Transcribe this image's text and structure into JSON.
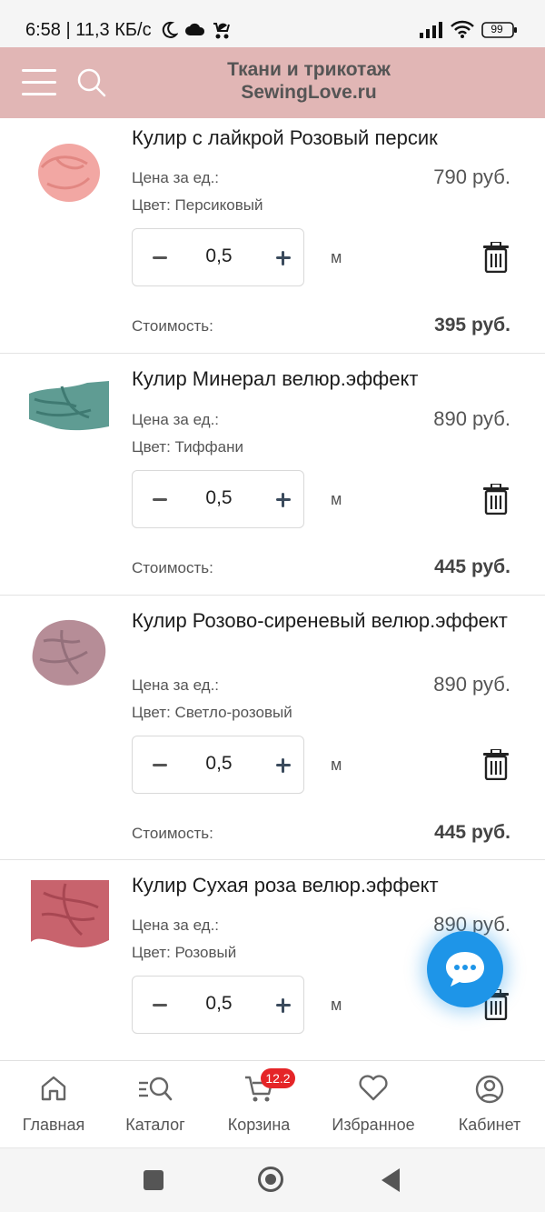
{
  "status_bar": {
    "time_speed": "6:58 | 11,3 КБ/с",
    "battery": "99"
  },
  "header": {
    "brand_line1": "Ткани и трикотаж",
    "brand_line2": "SewingLove.ru"
  },
  "cart": {
    "price_label": "Цена за ед.:",
    "cost_label": "Стоимость:",
    "items": [
      {
        "name": "Кулир с лайкрой Розовый персик",
        "price": "790 руб.",
        "color": "Цвет: Персиковый",
        "qty": "0,5",
        "unit": "м",
        "cost": "395 руб.",
        "swatch": "#f2a7a3"
      },
      {
        "name": "Кулир Минерал велюр.эффект",
        "price": "890 руб.",
        "color": "Цвет: Тиффани",
        "qty": "0,5",
        "unit": "м",
        "cost": "445 руб.",
        "swatch": "#5f9c93"
      },
      {
        "name": "Кулир Розово-сиреневый велюр.эффект",
        "price": "890 руб.",
        "color": "Цвет: Светло-розовый",
        "qty": "0,5",
        "unit": "м",
        "cost": "445 руб.",
        "swatch": "#b68d97"
      },
      {
        "name": "Кулир Сухая роза велюр.эффект",
        "price": "890 руб.",
        "color": "Цвет: Розовый",
        "qty": "0,5",
        "unit": "м",
        "swatch": "#c8636d"
      }
    ]
  },
  "bottom_nav": {
    "items": [
      {
        "label": "Главная",
        "icon": "home-icon"
      },
      {
        "label": "Каталог",
        "icon": "catalog-search-icon"
      },
      {
        "label": "Корзина",
        "icon": "cart-icon"
      },
      {
        "label": "Избранное",
        "icon": "heart-icon"
      },
      {
        "label": "Кабинет",
        "icon": "user-icon"
      }
    ],
    "cart_badge": "12.2"
  },
  "colors": {
    "header_bg": "#e1b6b5",
    "chat_fab": "#1e95e8",
    "badge": "#e52528"
  }
}
